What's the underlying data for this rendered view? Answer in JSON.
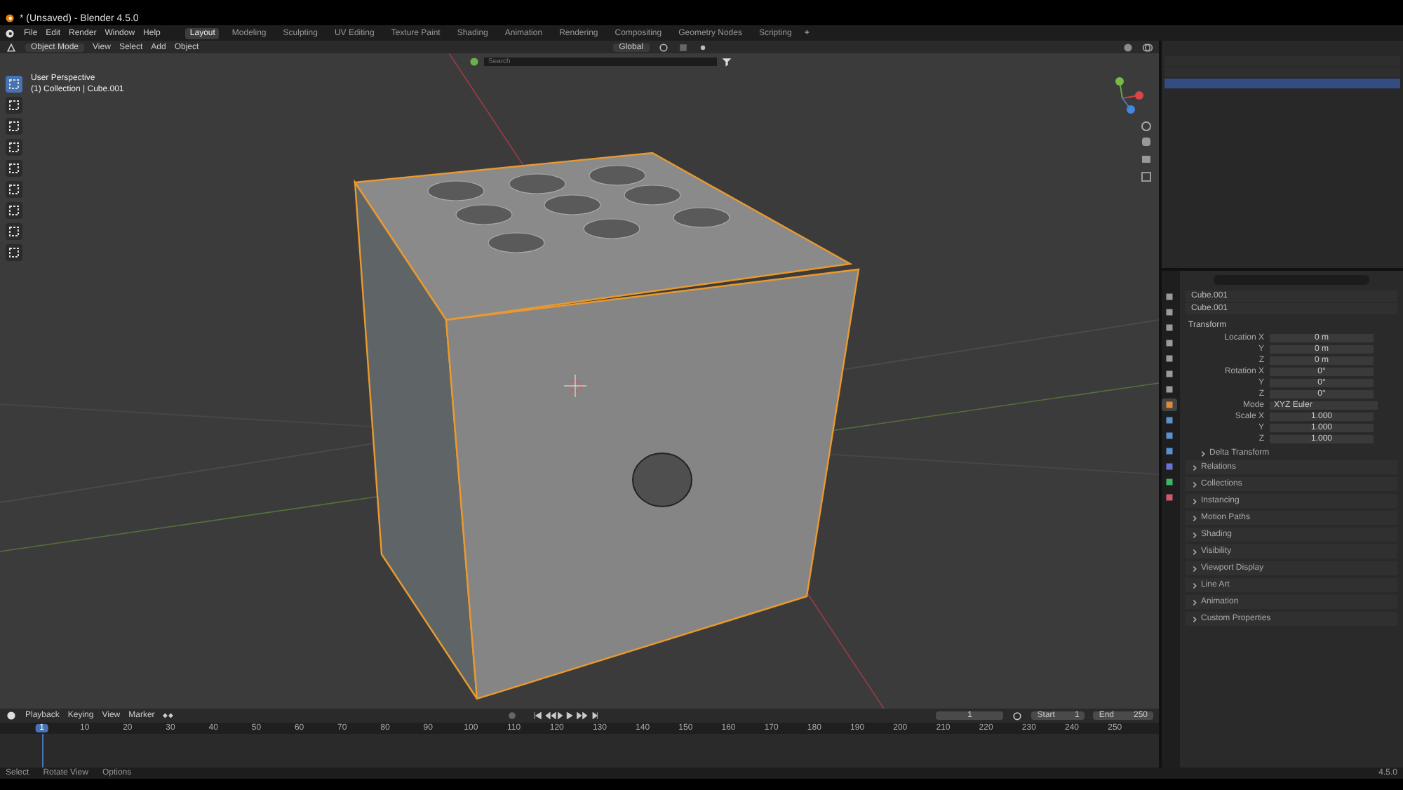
{
  "window": {
    "title": "* (Unsaved) - Blender 4.5.0"
  },
  "menu": [
    "File",
    "Edit",
    "Render",
    "Window",
    "Help"
  ],
  "workspaces": [
    {
      "label": "Layout",
      "selected": true
    },
    {
      "label": "Modeling",
      "selected": false
    },
    {
      "label": "Sculpting",
      "selected": false
    },
    {
      "label": "UV Editing",
      "selected": false
    },
    {
      "label": "Texture Paint",
      "selected": false
    },
    {
      "label": "Shading",
      "selected": false
    },
    {
      "label": "Animation",
      "selected": false
    },
    {
      "label": "Rendering",
      "selected": false
    },
    {
      "label": "Compositing",
      "selected": false
    },
    {
      "label": "Geometry Nodes",
      "selected": false
    },
    {
      "label": "Scripting",
      "selected": false
    }
  ],
  "workspace_add": "+",
  "viewport": {
    "mode": "Object Mode",
    "menu": [
      "View",
      "Select",
      "Add",
      "Object"
    ],
    "orientation": "Global",
    "search_placeholder": "Search",
    "overlay_lines": [
      "User Perspective",
      "(1) Collection | Cube.001"
    ],
    "tools": [
      {
        "selected": true
      },
      {
        "selected": false
      },
      {
        "selected": false
      },
      {
        "selected": false
      },
      {
        "selected": false
      },
      {
        "selected": false
      },
      {
        "selected": false
      },
      {
        "selected": false
      },
      {
        "selected": false
      }
    ]
  },
  "properties": {
    "tabs": [
      {
        "selected": false,
        "color": "#9a9a9a"
      },
      {
        "selected": false,
        "color": "#9a9a9a"
      },
      {
        "selected": false,
        "color": "#9a9a9a"
      },
      {
        "selected": false,
        "color": "#9a9a9a"
      },
      {
        "selected": false,
        "color": "#9a9a9a"
      },
      {
        "selected": false,
        "color": "#9a9a9a"
      },
      {
        "selected": false,
        "color": "#9a9a9a"
      },
      {
        "selected": true,
        "color": "#e08a3a"
      },
      {
        "selected": false,
        "color": "#5a8fd0"
      },
      {
        "selected": false,
        "color": "#5a8fd0"
      },
      {
        "selected": false,
        "color": "#5a8fd0"
      },
      {
        "selected": false,
        "color": "#6b6fd8"
      },
      {
        "selected": false,
        "color": "#3fb56a"
      },
      {
        "selected": false,
        "color": "#d05a6a"
      }
    ],
    "object_name": "Cube.001",
    "data_name": "Cube.001",
    "section": "Transform",
    "rows": [
      {
        "kind": "field",
        "label": "Location X",
        "value": "0 m"
      },
      {
        "kind": "field",
        "label": "Y",
        "value": "0 m"
      },
      {
        "kind": "field",
        "label": "Z",
        "value": "0 m"
      },
      {
        "kind": "field",
        "label": "Rotation X",
        "value": "0°"
      },
      {
        "kind": "field",
        "label": "Y",
        "value": "0°"
      },
      {
        "kind": "field",
        "label": "Z",
        "value": "0°"
      },
      {
        "kind": "dropdown",
        "label": "Mode",
        "value": "XYZ Euler"
      },
      {
        "kind": "field",
        "label": "Scale X",
        "value": "1.000"
      },
      {
        "kind": "field",
        "label": "Y",
        "value": "1.000"
      },
      {
        "kind": "field",
        "label": "Z",
        "value": "1.000"
      }
    ],
    "subsection": "Delta Transform",
    "panels": [
      "Relations",
      "Collections",
      "Instancing",
      "Motion Paths",
      "Shading",
      "Visibility",
      "Viewport Display",
      "Line Art",
      "Animation",
      "Custom Properties"
    ]
  },
  "timeline": {
    "menu": [
      "Playback",
      "Keying",
      "View",
      "Marker"
    ],
    "current_frame": "1",
    "start_label": "Start",
    "start": "1",
    "end_label": "End",
    "end": "250",
    "ticks": [
      "1",
      "10",
      "20",
      "30",
      "40",
      "50",
      "60",
      "70",
      "80",
      "90",
      "100",
      "110",
      "120",
      "130",
      "140",
      "150",
      "160",
      "170",
      "180",
      "190",
      "200",
      "210",
      "220",
      "230",
      "240",
      "250"
    ]
  },
  "status_bar": {
    "hints": [
      "Select",
      "Rotate View",
      "Options"
    ],
    "version": "4.5.0"
  }
}
